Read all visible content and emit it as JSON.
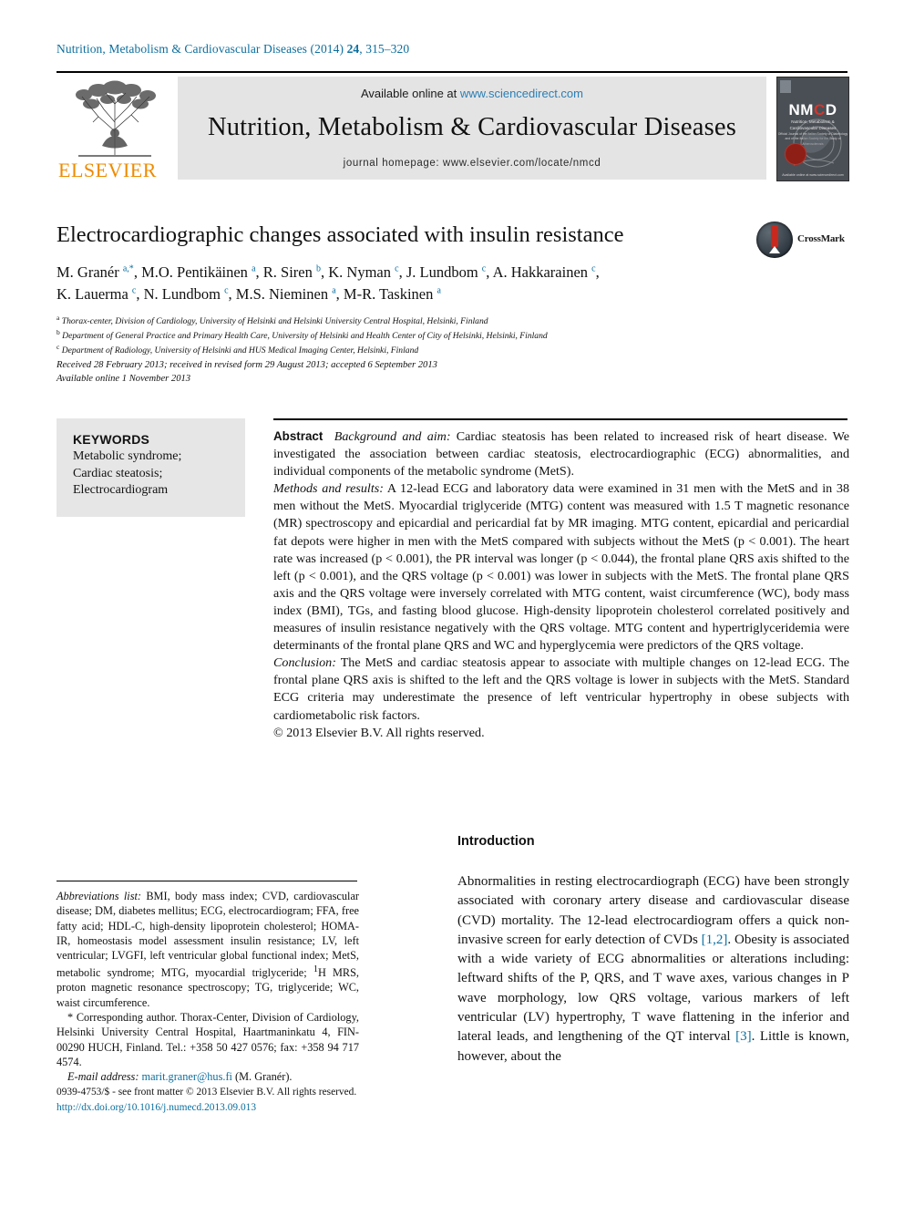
{
  "running_head": {
    "journal": "Nutrition, Metabolism & Cardiovascular Diseases (2014) ",
    "volume": "24",
    "pages": ", 315–320"
  },
  "masthead": {
    "available_online_label": "Available online at ",
    "sciencedirect_url": "www.sciencedirect.com",
    "journal_title": "Nutrition, Metabolism & Cardiovascular Diseases",
    "homepage_text": "journal homepage: www.elsevier.com/locate/nmcd",
    "publisher": "ELSEVIER",
    "cover": {
      "acronym_n": "NM",
      "acronym_c": "C",
      "acronym_d": "D",
      "cover_sub": "Nutrition, Metabolism &\nCardiovascular Diseases",
      "cover_sub2": "Official Journal of the Italian Society\nof Diabetology and of the Italian Society\nfor the Study of Atherosclerosis",
      "cover_footer": "Available online at www.sciencedirect.com"
    }
  },
  "article": {
    "title": "Electrocardiographic changes associated with insulin resistance",
    "crossmark_label": "CrossMark",
    "authors_line1": "M. Granér <sup>a,*</sup>, M.O. Pentikäinen <sup>a</sup>, R. Siren <sup>b</sup>, K. Nyman <sup>c</sup>, J. Lundbom <sup>c</sup>, A. Hakkarainen <sup>c</sup>,",
    "authors_line2": "K. Lauerma <sup>c</sup>, N. Lundbom <sup>c</sup>, M.S. Nieminen <sup>a</sup>, M-R. Taskinen <sup>a</sup>",
    "affiliation_a": "<sup>a</sup> Thorax-center, Division of Cardiology, University of Helsinki and Helsinki University Central Hospital, Helsinki, Finland",
    "affiliation_b": "<sup>b</sup> Department of General Practice and Primary Health Care, University of Helsinki and Health Center of City of Helsinki, Helsinki, Finland",
    "affiliation_c": "<sup>c</sup> Department of Radiology, University of Helsinki and HUS Medical Imaging Center, Helsinki, Finland",
    "received_line": "Received 28 February 2013; received in revised form 29 August 2013; accepted 6 September 2013",
    "available_line": "Available online 1 November 2013"
  },
  "keywords": {
    "heading": "KEYWORDS",
    "items": [
      "Metabolic syndrome;",
      "Cardiac steatosis;",
      "Electrocardiogram"
    ]
  },
  "abstract": {
    "label": "Abstract",
    "background_label": "Background and aim:",
    "background_text": " Cardiac steatosis has been related to increased risk of heart disease. We investigated the association between cardiac steatosis, electrocardiographic (ECG) abnormalities, and individual components of the metabolic syndrome (MetS).",
    "methods_label": "Methods and results:",
    "methods_text": " A 12-lead ECG and laboratory data were examined in 31 men with the MetS and in 38 men without the MetS. Myocardial triglyceride (MTG) content was measured with 1.5 T magnetic resonance (MR) spectroscopy and epicardial and pericardial fat by MR imaging. MTG content, epicardial and pericardial fat depots were higher in men with the MetS compared with subjects without the MetS (p < 0.001). The heart rate was increased (p < 0.001), the PR interval was longer (p < 0.044), the frontal plane QRS axis shifted to the left (p < 0.001), and the QRS voltage (p < 0.001) was lower in subjects with the MetS. The frontal plane QRS axis and the QRS voltage were inversely correlated with MTG content, waist circumference (WC), body mass index (BMI), TGs, and fasting blood glucose. High-density lipoprotein cholesterol correlated positively and measures of insulin resistance negatively with the QRS voltage. MTG content and hypertriglyceridemia were determinants of the frontal plane QRS and WC and hyperglycemia were predictors of the QRS voltage.",
    "conclusion_label": "Conclusion:",
    "conclusion_text": " The MetS and cardiac steatosis appear to associate with multiple changes on 12-lead ECG. The frontal plane QRS axis is shifted to the left and the QRS voltage is lower in subjects with the MetS. Standard ECG criteria may underestimate the presence of left ventricular hypertrophy in obese subjects with cardiometabolic risk factors.",
    "copyright": "© 2013 Elsevier B.V. All rights reserved."
  },
  "abbreviations": {
    "label": "Abbreviations list:",
    "text": " BMI, body mass index; CVD, cardiovascular disease; DM, diabetes mellitus; ECG, electrocardiogram; FFA, free fatty acid; HDL-C, high-density lipoprotein cholesterol; HOMA-IR, homeostasis model assessment insulin resistance; LV, left ventricular; LVGFI, left ventricular global functional index; MetS, metabolic syndrome; MTG, myocardial triglyceride; <sup>1</sup>H MRS, proton magnetic resonance spectroscopy; TG, triglyceride; WC, waist circumference."
  },
  "corresponding": {
    "text": "* Corresponding author. Thorax-Center, Division of Cardiology, Helsinki University Central Hospital, Haartmaninkatu 4, FIN-00290 HUCH, Finland. Tel.: +358 50 427 0576; fax: +358 94 717 4574.",
    "email_label": "E-mail address:",
    "email": "marit.graner@hus.fi",
    "email_suffix": " (M. Granér)."
  },
  "footer": {
    "issn_line": "0939-4753/$ - see front matter © 2013 Elsevier B.V. All rights reserved.",
    "doi": "http://dx.doi.org/10.1016/j.numecd.2013.09.013"
  },
  "introduction": {
    "heading": "Introduction",
    "paragraph_pre": "Abnormalities in resting electrocardiograph (ECG) have been strongly associated with coronary artery disease and cardiovascular disease (CVD) mortality. The 12-lead electrocardiogram offers a quick non-invasive screen for early detection of CVDs ",
    "ref1": "[1,2]",
    "paragraph_mid": ". Obesity is associated with a wide variety of ECG abnormalities or alterations including: leftward shifts of the P, QRS, and T wave axes, various changes in P wave morphology, low QRS voltage, various markers of left ventricular (LV) hypertrophy, T wave flattening in the inferior and lateral leads, and lengthening of the QT interval ",
    "ref2": "[3]",
    "paragraph_end": ". Little is known, however, about the"
  },
  "colors": {
    "link": "#0b6e9e",
    "elsevier_orange": "#ED8B00",
    "masthead_gray": "#e4e4e4",
    "keyword_gray": "#e6e6e6",
    "crossmark_red": "#c8281e"
  }
}
